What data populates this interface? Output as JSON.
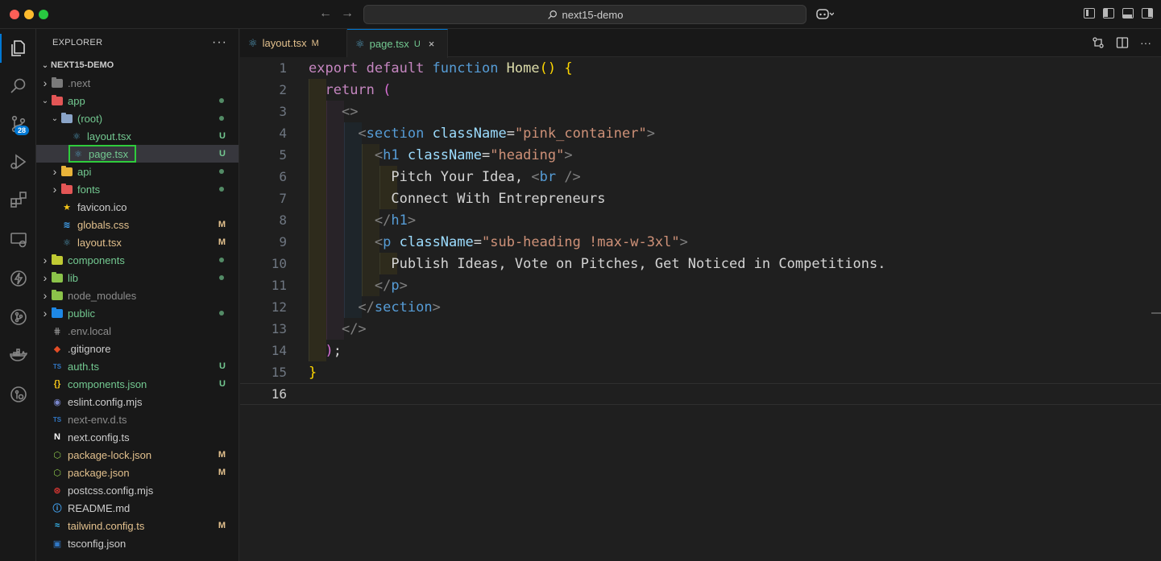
{
  "window": {
    "search_text": "next15-demo",
    "nav_back": "←",
    "nav_forward": "→"
  },
  "activity_bar": {
    "source_control_badge": "28",
    "items": [
      "explorer",
      "search",
      "source-control",
      "run-debug",
      "extensions",
      "remote-explorer",
      "thunder",
      "git-graph",
      "docker",
      "gitlens"
    ]
  },
  "explorer": {
    "header": "EXPLORER",
    "more": "···",
    "root_folder": "NEXT15-DEMO",
    "items": [
      {
        "name": ".next",
        "depth": 1,
        "kind": "folder",
        "expanded": false,
        "status": "",
        "color": "dim"
      },
      {
        "name": "app",
        "depth": 1,
        "kind": "folder",
        "expanded": true,
        "status": "dot",
        "color": "green"
      },
      {
        "name": "(root)",
        "depth": 2,
        "kind": "folder",
        "expanded": true,
        "status": "dot",
        "color": "green"
      },
      {
        "name": "layout.tsx",
        "depth": 3,
        "kind": "react",
        "status": "U",
        "color": "green"
      },
      {
        "name": "page.tsx",
        "depth": 3,
        "kind": "react",
        "status": "U",
        "color": "green",
        "selected": true
      },
      {
        "name": "api",
        "depth": 2,
        "kind": "folder",
        "expanded": false,
        "status": "dot",
        "color": "green"
      },
      {
        "name": "fonts",
        "depth": 2,
        "kind": "folder",
        "expanded": false,
        "status": "dot",
        "color": "green"
      },
      {
        "name": "favicon.ico",
        "depth": 2,
        "kind": "star",
        "status": "",
        "color": "plain"
      },
      {
        "name": "globals.css",
        "depth": 2,
        "kind": "css",
        "status": "M",
        "color": "yellow"
      },
      {
        "name": "layout.tsx",
        "depth": 2,
        "kind": "react",
        "status": "M",
        "color": "yellow"
      },
      {
        "name": "components",
        "depth": 1,
        "kind": "folder",
        "expanded": false,
        "status": "dot",
        "color": "green"
      },
      {
        "name": "lib",
        "depth": 1,
        "kind": "folder",
        "expanded": false,
        "status": "dot",
        "color": "green"
      },
      {
        "name": "node_modules",
        "depth": 1,
        "kind": "folder",
        "expanded": false,
        "status": "",
        "color": "dim"
      },
      {
        "name": "public",
        "depth": 1,
        "kind": "folder",
        "expanded": false,
        "status": "dot",
        "color": "green"
      },
      {
        "name": ".env.local",
        "depth": 1,
        "kind": "env",
        "status": "",
        "color": "dim"
      },
      {
        "name": ".gitignore",
        "depth": 1,
        "kind": "git",
        "status": "",
        "color": "plain"
      },
      {
        "name": "auth.ts",
        "depth": 1,
        "kind": "ts",
        "status": "U",
        "color": "green"
      },
      {
        "name": "components.json",
        "depth": 1,
        "kind": "json",
        "status": "U",
        "color": "green"
      },
      {
        "name": "eslint.config.mjs",
        "depth": 1,
        "kind": "eslint",
        "status": "",
        "color": "plain"
      },
      {
        "name": "next-env.d.ts",
        "depth": 1,
        "kind": "ts",
        "status": "",
        "color": "dim"
      },
      {
        "name": "next.config.ts",
        "depth": 1,
        "kind": "next",
        "status": "",
        "color": "plain"
      },
      {
        "name": "package-lock.json",
        "depth": 1,
        "kind": "npm",
        "status": "M",
        "color": "yellow"
      },
      {
        "name": "package.json",
        "depth": 1,
        "kind": "npm",
        "status": "M",
        "color": "yellow"
      },
      {
        "name": "postcss.config.mjs",
        "depth": 1,
        "kind": "postcss",
        "status": "",
        "color": "plain"
      },
      {
        "name": "README.md",
        "depth": 1,
        "kind": "info",
        "status": "",
        "color": "plain"
      },
      {
        "name": "tailwind.config.ts",
        "depth": 1,
        "kind": "tailwind",
        "status": "M",
        "color": "yellow"
      },
      {
        "name": "tsconfig.json",
        "depth": 1,
        "kind": "tsconfig",
        "status": "",
        "color": "plain"
      }
    ]
  },
  "tabs": [
    {
      "label": "layout.tsx",
      "status": "M",
      "active": false
    },
    {
      "label": "page.tsx",
      "status": "U",
      "active": true
    }
  ],
  "close_glyph": "×",
  "editor": {
    "current_line": 16,
    "lines": [
      {
        "n": "1",
        "tokens": [
          [
            "kw2",
            "export "
          ],
          [
            "kw2",
            "default "
          ],
          [
            "kw",
            "function "
          ],
          [
            "fn",
            "Home"
          ],
          [
            "br1",
            "() {"
          ]
        ]
      },
      {
        "n": "2",
        "tokens": [
          [
            "txt",
            "  "
          ],
          [
            "kw2",
            "return "
          ],
          [
            "br2",
            "("
          ]
        ]
      },
      {
        "n": "3",
        "tokens": [
          [
            "txt",
            "    "
          ],
          [
            "tagp",
            "<>"
          ]
        ]
      },
      {
        "n": "4",
        "tokens": [
          [
            "txt",
            "      "
          ],
          [
            "tagp",
            "<"
          ],
          [
            "tag",
            "section "
          ],
          [
            "attr",
            "className"
          ],
          [
            "txt",
            "="
          ],
          [
            "str",
            "\"pink_container\""
          ],
          [
            "tagp",
            ">"
          ]
        ]
      },
      {
        "n": "5",
        "tokens": [
          [
            "txt",
            "        "
          ],
          [
            "tagp",
            "<"
          ],
          [
            "tag",
            "h1 "
          ],
          [
            "attr",
            "className"
          ],
          [
            "txt",
            "="
          ],
          [
            "str",
            "\"heading\""
          ],
          [
            "tagp",
            ">"
          ]
        ]
      },
      {
        "n": "6",
        "tokens": [
          [
            "txt",
            "          Pitch Your Idea, "
          ],
          [
            "tagp",
            "<"
          ],
          [
            "tag",
            "br "
          ],
          [
            "tagp",
            "/>"
          ]
        ]
      },
      {
        "n": "7",
        "tokens": [
          [
            "txt",
            "          Connect With Entrepreneurs"
          ]
        ]
      },
      {
        "n": "8",
        "tokens": [
          [
            "txt",
            "        "
          ],
          [
            "tagp",
            "</"
          ],
          [
            "tag",
            "h1"
          ],
          [
            "tagp",
            ">"
          ]
        ]
      },
      {
        "n": "9",
        "tokens": [
          [
            "txt",
            "        "
          ],
          [
            "tagp",
            "<"
          ],
          [
            "tag",
            "p "
          ],
          [
            "attr",
            "className"
          ],
          [
            "txt",
            "="
          ],
          [
            "str",
            "\"sub-heading !max-w-3xl\""
          ],
          [
            "tagp",
            ">"
          ]
        ]
      },
      {
        "n": "10",
        "tokens": [
          [
            "txt",
            "          Publish Ideas, Vote on Pitches, Get Noticed in Competitions."
          ]
        ]
      },
      {
        "n": "11",
        "tokens": [
          [
            "txt",
            "        "
          ],
          [
            "tagp",
            "</"
          ],
          [
            "tag",
            "p"
          ],
          [
            "tagp",
            ">"
          ]
        ]
      },
      {
        "n": "12",
        "tokens": [
          [
            "txt",
            "      "
          ],
          [
            "tagp",
            "</"
          ],
          [
            "tag",
            "section"
          ],
          [
            "tagp",
            ">"
          ]
        ]
      },
      {
        "n": "13",
        "tokens": [
          [
            "txt",
            "    "
          ],
          [
            "tagp",
            "</>"
          ]
        ]
      },
      {
        "n": "14",
        "tokens": [
          [
            "txt",
            "  "
          ],
          [
            "br2",
            ")"
          ],
          [
            "txt",
            ";"
          ]
        ]
      },
      {
        "n": "15",
        "tokens": [
          [
            "br1",
            "}"
          ]
        ]
      },
      {
        "n": "16",
        "tokens": []
      }
    ]
  },
  "colors": {
    "accent": "#0078d4",
    "git_untracked": "#73c991",
    "git_modified": "#e2c08d",
    "highlight_box": "#2fcc3c"
  }
}
